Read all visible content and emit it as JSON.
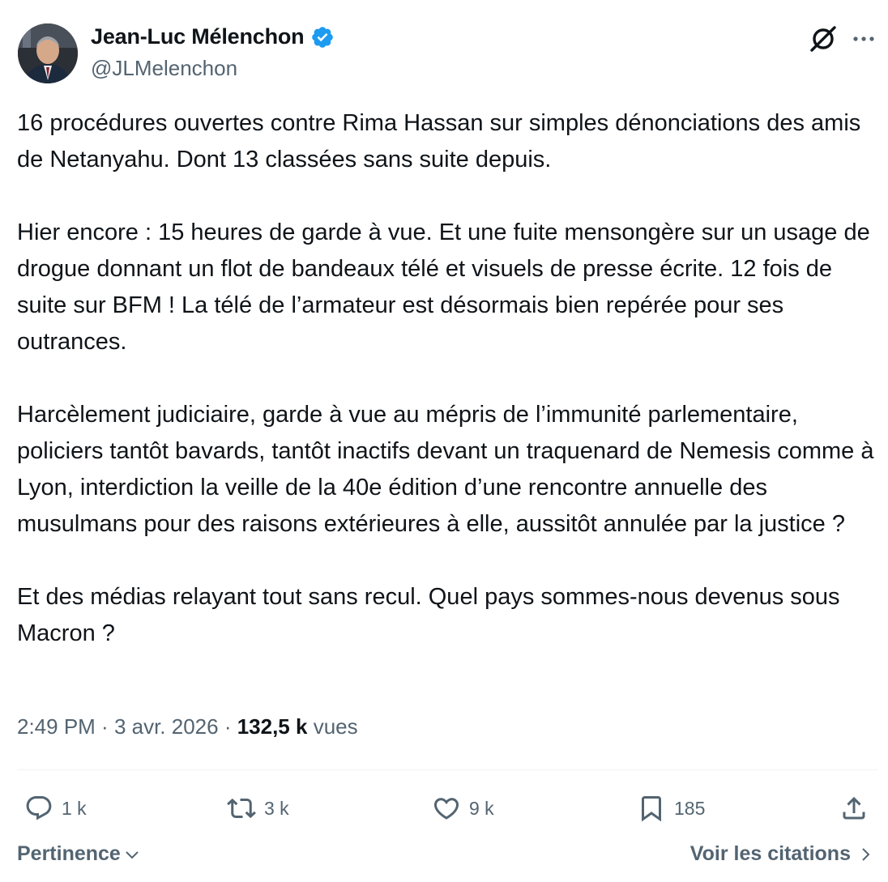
{
  "author": {
    "display_name": "Jean-Luc Mélenchon",
    "handle": "@JLMelenchon",
    "verified_color": "#1d9bf0"
  },
  "tweet": {
    "paragraphs": [
      "16 procédures ouvertes contre Rima Hassan sur simples dénonciations des amis de Netanyahu. Dont 13 classées sans suite depuis.",
      "Hier encore : 15 heures de garde à vue. Et une fuite mensongère sur un usage de drogue donnant un flot de bandeaux télé et visuels de presse écrite. 12 fois de suite sur BFM ! La télé de l’armateur est désormais bien repérée pour ses outrances.",
      "Harcèlement judiciaire, garde à vue au mépris de l’immunité parlementaire, policiers tantôt bavards, tantôt inactifs devant un traquenard de Nemesis comme à Lyon, interdiction la veille de la 40e édition d’une rencontre annuelle des musulmans pour des raisons extérieures à elle, aussitôt annulée par la justice ?",
      "Et des médias relayant tout sans recul. Quel pays sommes-nous devenus sous Macron ?"
    ]
  },
  "meta": {
    "time": "2:49 PM",
    "separator": " · ",
    "date": "3 avr. 2026",
    "views_count": "132,5 k",
    "views_label": "vues"
  },
  "actions": {
    "replies": "1 k",
    "retweets": "3 k",
    "likes": "9 k",
    "bookmarks": "185"
  },
  "footer": {
    "sort_label": "Pertinence",
    "quotes_label": "Voir les citations"
  },
  "icons": {
    "verified": "verified-badge-icon",
    "grok": "grok-icon",
    "more": "more-horizontal-icon",
    "reply": "reply-icon",
    "retweet": "retweet-icon",
    "like": "heart-icon",
    "bookmark": "bookmark-icon",
    "share": "share-icon"
  }
}
